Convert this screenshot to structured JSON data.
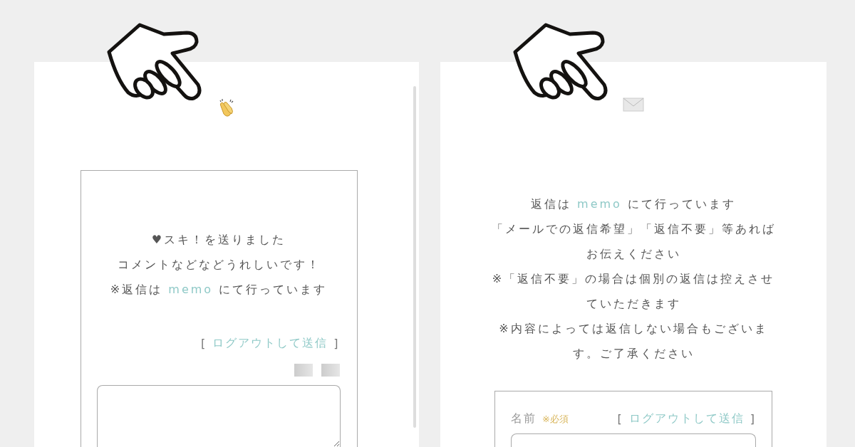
{
  "left_panel": {
    "message_lines": [
      "♥スキ！を送りました",
      "コメントなどなどうれしいです！"
    ],
    "reply_note": {
      "before": "※返信は",
      "link": "memo",
      "after": "にて行っています"
    },
    "logout": {
      "open": "[",
      "label": "ログアウトして送信",
      "close": "]"
    }
  },
  "right_panel": {
    "reply_note": {
      "before": "返信は",
      "link": "memo",
      "after": "にて行っています"
    },
    "notes": [
      "「メールでの返信希望」「返信不要」等あればお伝えください",
      "※「返信不要」の場合は個別の返信は控えさせていただきます",
      "※内容によっては返信しない場合もございます。ご了承ください"
    ],
    "form": {
      "name_label": "名前",
      "required_mark": "※必須",
      "logout": {
        "open": "[",
        "label": "ログアウトして送信",
        "close": "]"
      }
    }
  }
}
